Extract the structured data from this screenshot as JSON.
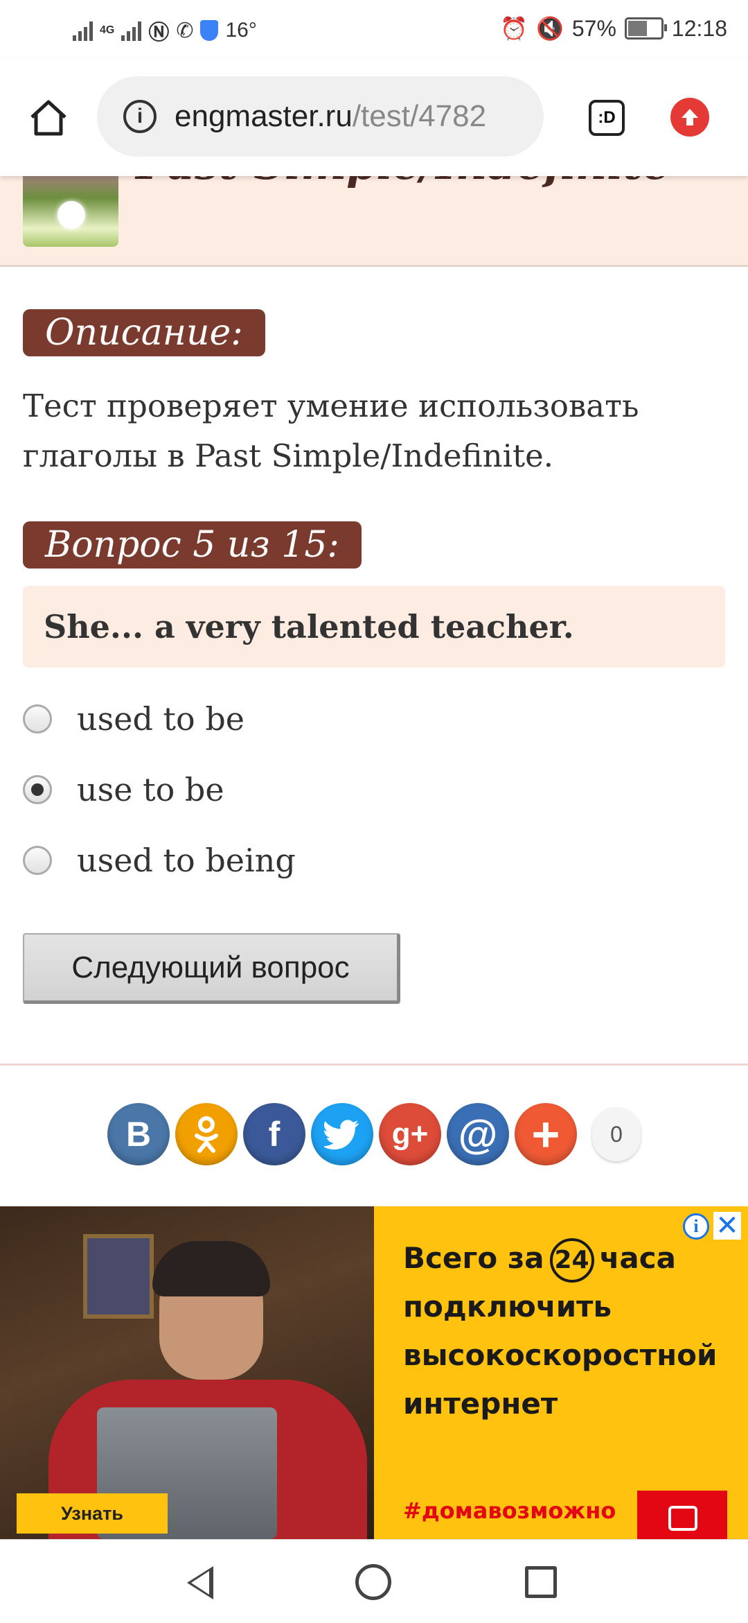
{
  "status_bar": {
    "network": "4G",
    "temperature": "16°",
    "battery": "57%",
    "time": "12:18"
  },
  "browser": {
    "url_host": "engmaster.ru",
    "url_path": "/test/4782",
    "tabs_label": ":D"
  },
  "page": {
    "title": "Past Simple/Indefinite",
    "description_label": "Описание:",
    "description_text": "Тест проверяет умение использовать глаголы в Past Simple/Indefinite.",
    "question_label": "Вопрос 5 из 15:",
    "question_text": "She... a very talented teacher.",
    "options": [
      {
        "label": "used to be",
        "checked": false
      },
      {
        "label": "use to be",
        "checked": true
      },
      {
        "label": "used to being",
        "checked": false
      }
    ],
    "next_button": "Следующий вопрос"
  },
  "share": {
    "buttons": [
      {
        "name": "vkontakte",
        "glyph": "В",
        "color": "#4a76a8"
      },
      {
        "name": "odnoklassniki",
        "glyph": "ok",
        "color": "#f2a000"
      },
      {
        "name": "facebook",
        "glyph": "f",
        "color": "#3b5998"
      },
      {
        "name": "twitter",
        "glyph": "t",
        "color": "#1da1f2"
      },
      {
        "name": "google-plus",
        "glyph": "g+",
        "color": "#dd4b39"
      },
      {
        "name": "mail",
        "glyph": "@",
        "color": "#3a6fb5"
      },
      {
        "name": "more",
        "glyph": "+",
        "color": "#ef5a35"
      }
    ],
    "count": "0"
  },
  "ad": {
    "headline_part1": "Всего за",
    "headline_number": "24",
    "headline_part2": "часа",
    "headline_rest": "подключить высокоскоростной интернет",
    "hashtag": "#домавозможно",
    "cta": "Узнать"
  }
}
